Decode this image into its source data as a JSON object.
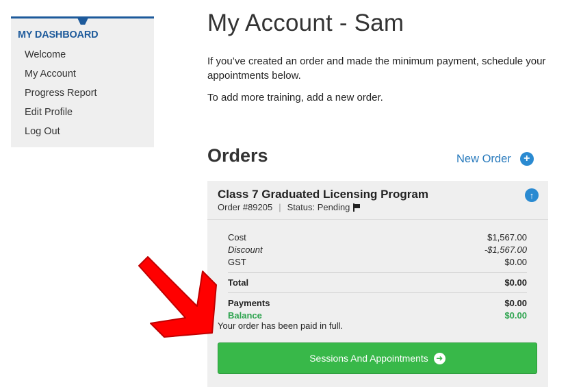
{
  "sidebar": {
    "title": "MY DASHBOARD",
    "items": [
      {
        "label": "Welcome"
      },
      {
        "label": "My Account"
      },
      {
        "label": "Progress Report"
      },
      {
        "label": "Edit Profile"
      },
      {
        "label": "Log Out"
      }
    ]
  },
  "main": {
    "title": "My Account - Sam",
    "intro": "If you’ve created an order and made the minimum payment, schedule your appointments below.",
    "intro2": "To add more training, add a new order.",
    "orders_heading": "Orders",
    "new_order_label": "New Order",
    "new_order_icon": "plus-circle-icon"
  },
  "order": {
    "title": "Class 7 Graduated Licensing Program",
    "number": "Order #89205",
    "separator": "|",
    "status": "Status: Pending",
    "collapse_icon": "arrow-up-circle-icon",
    "cost_label": "Cost",
    "cost_value": "$1,567.00",
    "discount_label": "Discount",
    "discount_value": "-$1,567.00",
    "gst_label": "GST",
    "gst_value": "$0.00",
    "total_label": "Total",
    "total_value": "$0.00",
    "payments_label": "Payments",
    "payments_value": "$0.00",
    "balance_label": "Balance",
    "balance_value": "$0.00",
    "paid_message": "Your order has been paid in full.",
    "sessions_button": "Sessions And Appointments",
    "sessions_icon": "arrow-right-circle-icon"
  },
  "colors": {
    "brand_blue": "#1d5a9b",
    "link_blue": "#2a7bbd",
    "success_green": "#38b849",
    "annotation_red": "#ff0000"
  }
}
